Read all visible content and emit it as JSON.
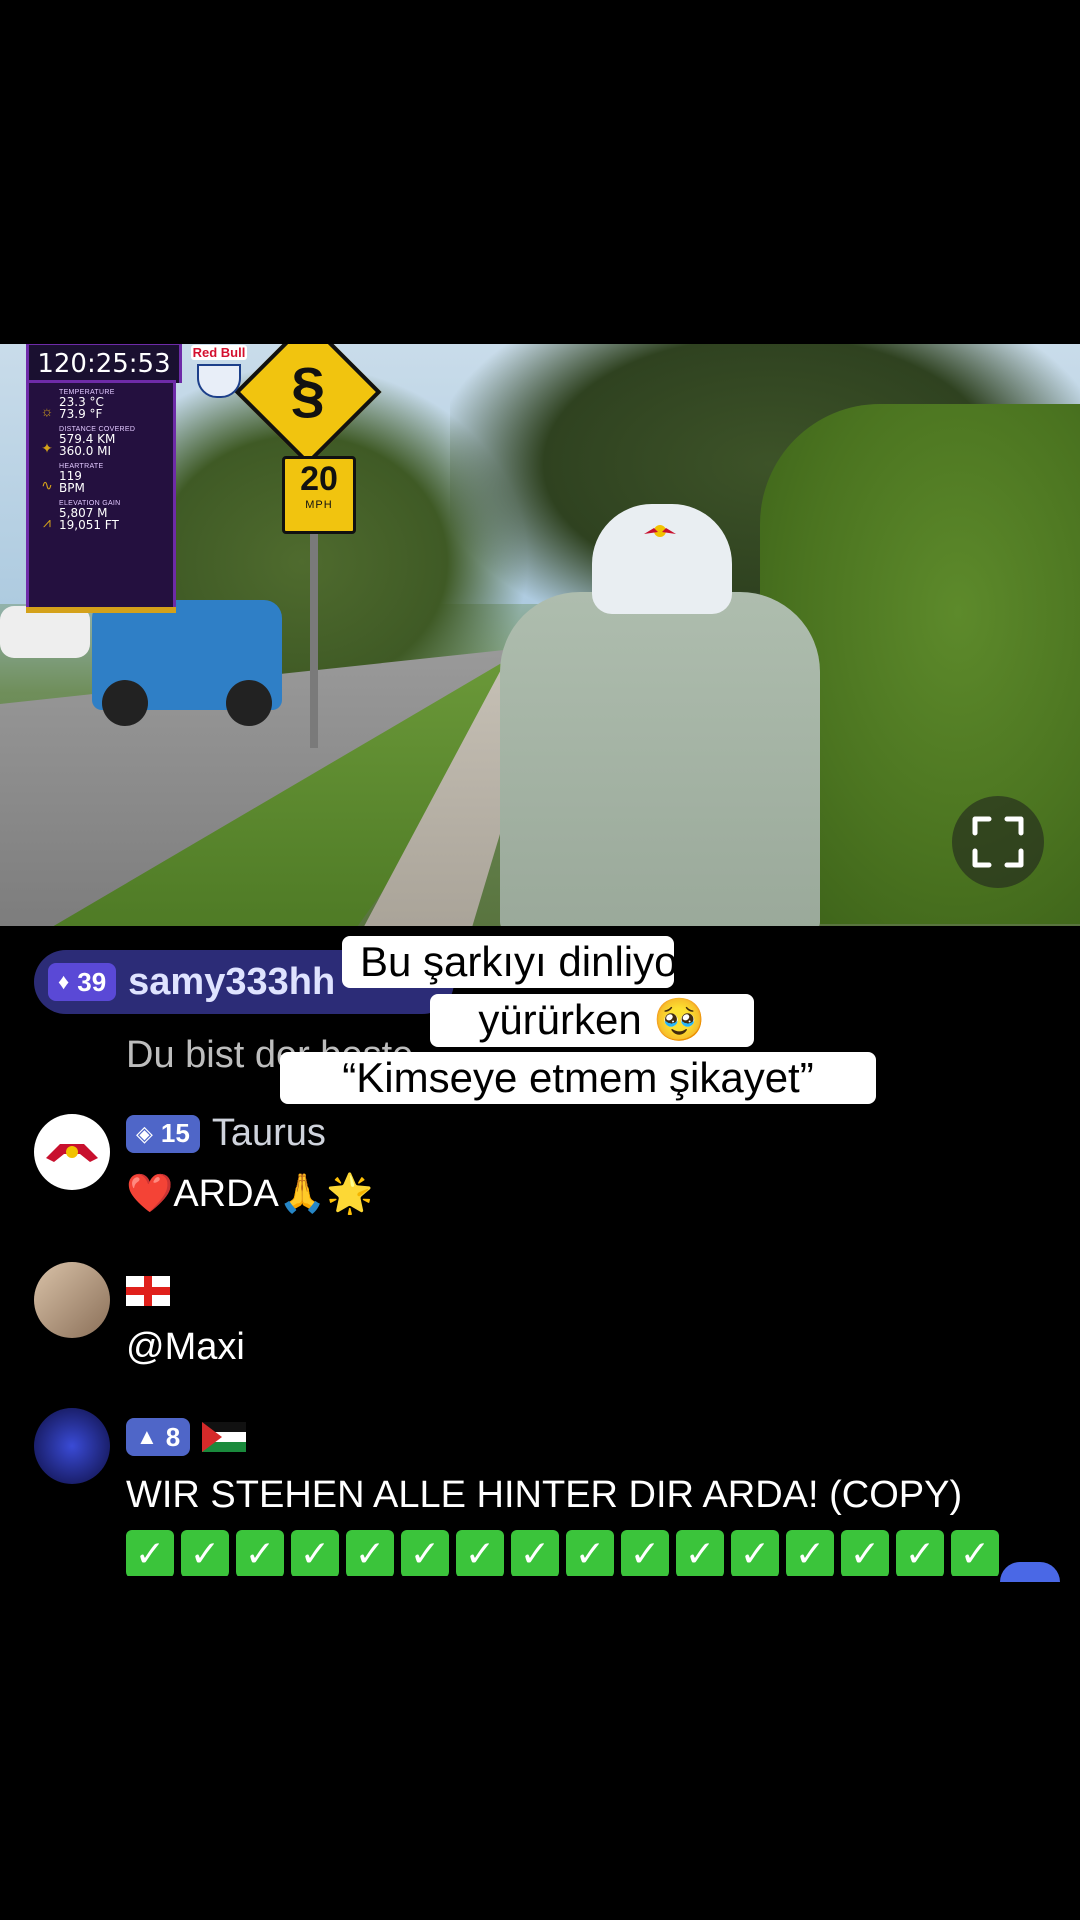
{
  "hud": {
    "timer": "120:25:53",
    "logo_text": "Red Bull",
    "stats": [
      {
        "icon": "sun-icon",
        "label": "Temperature",
        "value1": "23.3 °C",
        "value2": "73.9 °F"
      },
      {
        "icon": "runner-icon",
        "label": "Distance covered",
        "value1": "579.4 KM",
        "value2": "360.0 MI"
      },
      {
        "icon": "heartbeat-icon",
        "label": "Heartrate",
        "value1": "119",
        "value2": "BPM"
      },
      {
        "icon": "mountain-icon",
        "label": "Elevation gain",
        "value1": "5,807 M",
        "value2": "19,051 FT"
      }
    ],
    "accent": "#6e2ba8",
    "gold": "#d4a11a"
  },
  "scene": {
    "speed_sign_number": "20",
    "speed_sign_unit": "MPH",
    "hat_logo": "Red Bull"
  },
  "caption": {
    "line1": "Bu şarkıyı dinliyordu",
    "line2": "yürürken 🥹",
    "line3": "“Kimseye etmem şikayet”"
  },
  "chat": {
    "pinned": {
      "badge": "39",
      "user": "samy333hh",
      "message": "Du bist der beste"
    },
    "messages": [
      {
        "avatar": "red-bull-avatar",
        "badge": "15",
        "user": "Taurus",
        "text": "❤️ARDA🙏🌟"
      },
      {
        "avatar": "girl-avatar",
        "flag": "georgia-flag",
        "text": "@Maxi"
      },
      {
        "avatar": "concert-avatar",
        "badge": "8",
        "flag": "palestine-flag",
        "text": "WIR STEHEN ALLE HINTER DIR ARDA! (COPY)",
        "checks": 16
      }
    ]
  },
  "colors": {
    "badge_blue": "#4f66c8",
    "pill_bg": "#2c2c77",
    "check_green": "#3bc43b"
  }
}
